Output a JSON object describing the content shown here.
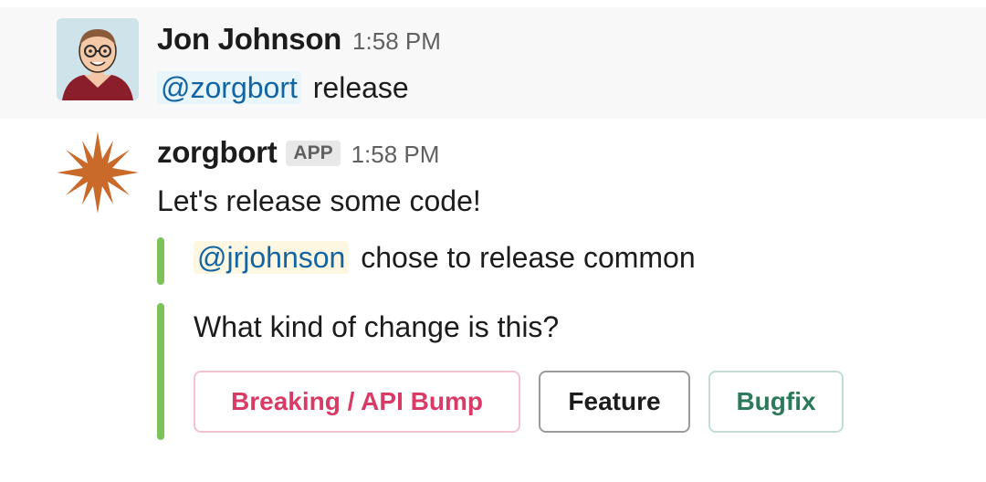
{
  "messages": [
    {
      "sender": "Jon Johnson",
      "timestamp": "1:58 PM",
      "mention": "@zorgbort",
      "text": "release"
    },
    {
      "sender": "zorgbort",
      "badge": "APP",
      "timestamp": "1:58 PM",
      "text": "Let's release some code!",
      "attachments": [
        {
          "mention": "@jrjohnson",
          "text": "chose to release common"
        },
        {
          "text": "What kind of change is this?",
          "buttons": [
            {
              "label": "Breaking / API Bump",
              "style": "danger"
            },
            {
              "label": "Feature",
              "style": "default"
            },
            {
              "label": "Bugfix",
              "style": "primary"
            }
          ]
        }
      ]
    }
  ],
  "colors": {
    "attachment_bar": "#7dc257",
    "mention_text": "#1264a3",
    "danger": "#d83c66",
    "primary": "#2b7a5a",
    "bot_avatar": "#c9692a"
  },
  "icons": {
    "user_avatar": "avatar-cartoon-man-glasses",
    "bot_avatar": "starburst-icon"
  }
}
